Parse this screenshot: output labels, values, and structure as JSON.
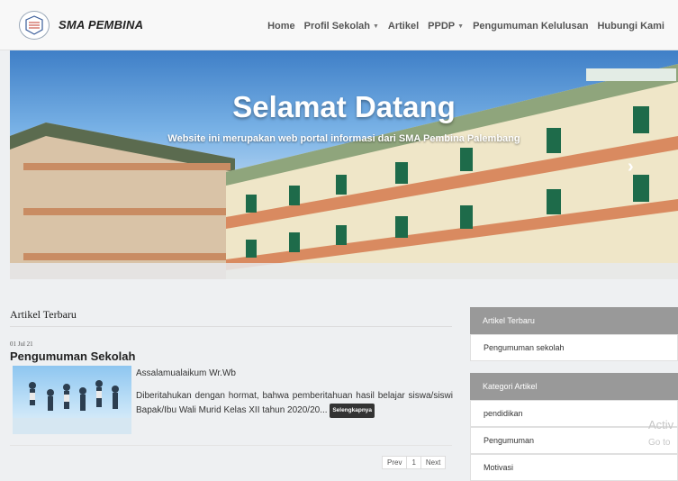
{
  "brand": {
    "name": "SMA PEMBINA"
  },
  "nav": {
    "items": [
      {
        "label": "Home",
        "dropdown": false
      },
      {
        "label": "Profil Sekolah",
        "dropdown": true
      },
      {
        "label": "Artikel",
        "dropdown": false
      },
      {
        "label": "PPDP",
        "dropdown": true
      },
      {
        "label": "Pengumuman Kelulusan",
        "dropdown": false
      },
      {
        "label": "Hubungi Kami",
        "dropdown": false
      }
    ]
  },
  "hero": {
    "title": "Selamat Datang",
    "subtitle": "Website ini merupakan web portal informasi dari SMA Pembina Palembang"
  },
  "main": {
    "section_title": "Artikel Terbaru",
    "post": {
      "date": "01 Jul 21",
      "title": "Pengumuman Sekolah",
      "greeting": "Assalamualaikum Wr.Wb",
      "excerpt": "Diberitahukan dengan hormat, bahwa pemberitahuan hasil belajar siswa/siswi Bapak/Ibu Wali Murid Kelas XII tahun 2020/20...",
      "more_label": "Selengkapnya"
    },
    "pagination": {
      "prev": "Prev",
      "current": "1",
      "next": "Next"
    }
  },
  "sidebar": {
    "recent": {
      "title": "Artikel Terbaru",
      "items": [
        "Pengumuman sekolah"
      ]
    },
    "categories": {
      "title": "Kategori Artikel",
      "items": [
        "pendidikan",
        "Pengumuman",
        "Motivasi"
      ]
    }
  },
  "watermark": {
    "line1": "Activ",
    "line2": "Go to"
  }
}
